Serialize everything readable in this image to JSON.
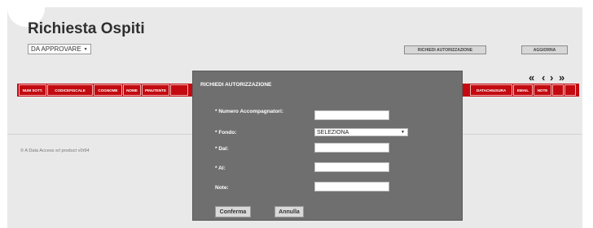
{
  "header": {
    "title": "Richiesta Ospiti",
    "status_filter": {
      "selected": "DA APPROVARE"
    },
    "request_auth_label": "RICHIEDI AUTORIZZAZIONE",
    "refresh_label": "AGGIORNA"
  },
  "table": {
    "columns_left": [
      "NUM SOTT.",
      "CODICEFISCALE",
      "COGNOME",
      "NOME",
      "PINUTENTE"
    ],
    "columns_right": [
      "DATACHIUSURA",
      "EMAIL",
      "NOTE"
    ]
  },
  "pagination": {
    "first": "«",
    "prev": "‹",
    "next": "›",
    "last": "»"
  },
  "footer": {
    "text": "© A Data Access srl product v0r94"
  },
  "modal": {
    "title": "RICHIEDI AUTORIZZAZIONE",
    "fields": {
      "accompagnatori_label": "* Numero Accompagnatori:",
      "accompagnatori_value": "",
      "fondo_label": "* Fondo:",
      "fondo_value": "SELEZIONA",
      "dal_label": "* Dal:",
      "dal_value": "",
      "al_label": "* Al:",
      "al_value": "",
      "note_label": "Note:",
      "note_value": ""
    },
    "confirm_label": "Conferma",
    "cancel_label": "Annulla"
  },
  "colors": {
    "table_header": "#c20a10",
    "modal_bg": "#6f6f6f",
    "page_bg": "#e9e9e9"
  }
}
